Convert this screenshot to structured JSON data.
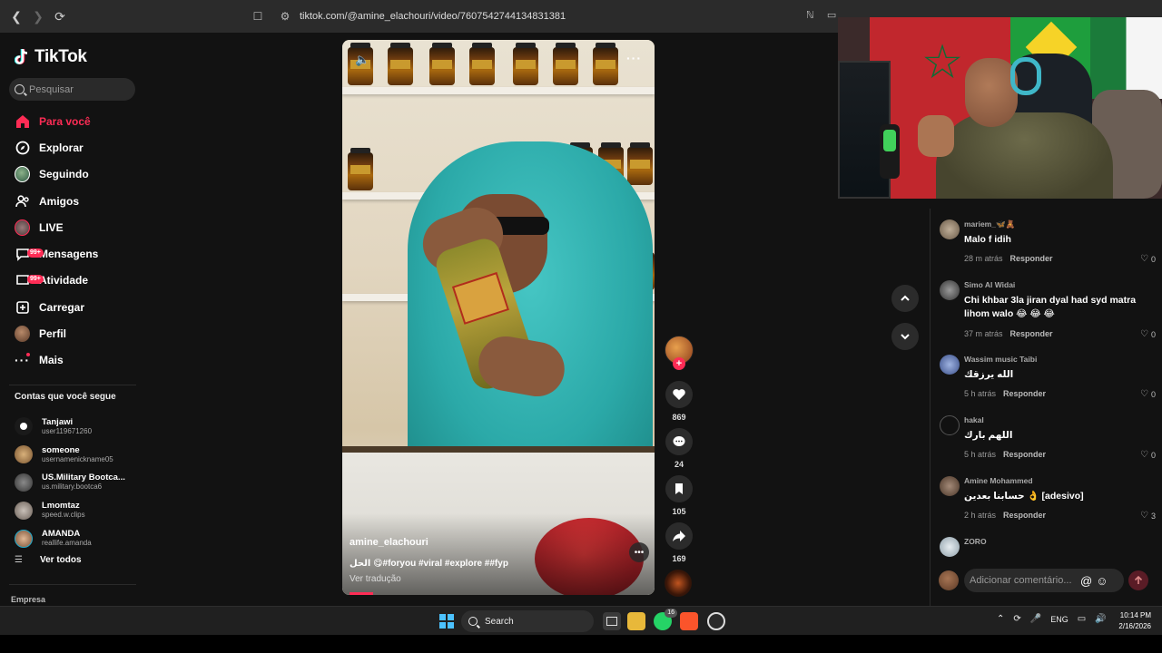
{
  "browser": {
    "url": "tiktok.com/@amine_elachouri/video/7607542744134831381"
  },
  "sidebar": {
    "logo_text": "TikTok",
    "search_placeholder": "Pesquisar",
    "menu": [
      {
        "label": "Para você",
        "icon": "home-icon",
        "active": true
      },
      {
        "label": "Explorar",
        "icon": "compass-icon"
      },
      {
        "label": "Seguindo",
        "icon": "following-avatar-icon"
      },
      {
        "label": "Amigos",
        "icon": "friends-icon"
      },
      {
        "label": "LIVE",
        "icon": "live-icon"
      },
      {
        "label": "Mensagens",
        "icon": "messages-icon",
        "badge": "99+"
      },
      {
        "label": "Atividade",
        "icon": "activity-icon",
        "badge": "99+"
      },
      {
        "label": "Carregar",
        "icon": "upload-icon"
      },
      {
        "label": "Perfil",
        "icon": "profile-avatar-icon"
      },
      {
        "label": "Mais",
        "icon": "more-dots-icon"
      }
    ],
    "following_title": "Contas que você segue",
    "following": [
      {
        "name": "Tanjawi",
        "user": "user119671260",
        "color": "#e8e8e8"
      },
      {
        "name": "someone",
        "user": "usernamenickname05",
        "color": "#b48a52"
      },
      {
        "name": "US.Military Bootca...",
        "user": "us.military.bootca6",
        "color": "#5a5a5a"
      },
      {
        "name": "Lmomtaz",
        "user": "speed.w.clips",
        "color": "#9a8f86"
      },
      {
        "name": "AMANDA",
        "user": "reallife.amanda",
        "color": "#c49b7a"
      }
    ],
    "see_all": "Ver todos",
    "company": "Empresa"
  },
  "video": {
    "author": "amine_elachouri",
    "caption": "الحل 😋#foryou #viral #explore ##fyp",
    "translate": "Ver tradução",
    "progress": 0.08
  },
  "actions": {
    "likes": "869",
    "comments": "24",
    "saves": "105",
    "shares": "169"
  },
  "comments": [
    {
      "user": "mariem_🦋🧸",
      "text": "Malo f idih",
      "time": "28 m atrás",
      "likes": "0",
      "color": "#8a7b6a"
    },
    {
      "user": "Simo Al Widai",
      "text": "Chi khbar 3la jiran dyal had syd matra lihom walo 😂 😂 😂",
      "time": "37 m atrás",
      "likes": "0",
      "color": "#5c5c5c"
    },
    {
      "user": "Wassim music Taibi",
      "text": "الله يرزقك",
      "time": "5 h atrás",
      "likes": "0",
      "color": "#6a7fb0"
    },
    {
      "user": "hakal",
      "text": "اللهم بارك",
      "time": "5 h atrás",
      "likes": "0",
      "color": "#1a1a1a"
    },
    {
      "user": "Amine Mohammed",
      "text": "حسابنا بعدين 👌 [adesivo]",
      "time": "2 h atrás",
      "likes": "3",
      "color": "#7a6355"
    },
    {
      "user": "ZORO",
      "text": "",
      "time": "",
      "likes": "",
      "color": "#cfd6dc"
    }
  ],
  "reply_label": "Responder",
  "comment_input_placeholder": "Adicionar comentário...",
  "taskbar": {
    "search_label": "Search",
    "lang": "ENG",
    "time": "10:14 PM",
    "date": "2/16/2026",
    "whatsapp_badge": "16"
  }
}
